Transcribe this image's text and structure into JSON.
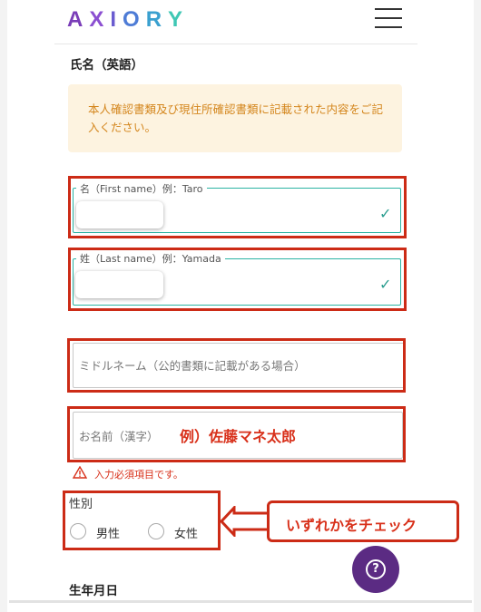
{
  "header": {
    "logo_letters": [
      {
        "ch": "A",
        "color": "#7a3db8"
      },
      {
        "ch": "X",
        "color": "#8b4fd1"
      },
      {
        "ch": "I",
        "color": "#6a5cd0"
      },
      {
        "ch": "O",
        "color": "#4e7cd6"
      },
      {
        "ch": "R",
        "color": "#3aa0cf"
      },
      {
        "ch": "Y",
        "color": "#3fc7b4"
      }
    ]
  },
  "section": {
    "name_english_label": "氏名（英語）"
  },
  "notice": {
    "text": "本人確認書類及び現住所確認書類に記載された内容をご記入ください。"
  },
  "fields": {
    "first_name": {
      "legend": "名（First name）例：Taro",
      "status_icon": "check-icon"
    },
    "last_name": {
      "legend": "姓（Last name）例：Yamada",
      "status_icon": "check-icon"
    },
    "middle_name": {
      "placeholder": "ミドルネーム（公的書類に記載がある場合）"
    },
    "kanji_name": {
      "placeholder": "お名前（漢字）",
      "example": "例）佐藤マネ太郎"
    }
  },
  "error": {
    "icon": "warning-icon",
    "text": "入力必須項目です。"
  },
  "gender": {
    "label": "性別",
    "options": [
      "男性",
      "女性"
    ]
  },
  "callout": {
    "text": "いずれかをチェック"
  },
  "next_section": {
    "label": "生年月日"
  },
  "colors": {
    "accent_teal": "#2bb3a3",
    "annotation_red": "#cc2b16",
    "help_purple": "#5b2b83",
    "notice_bg": "#fdf3e0",
    "notice_text": "#d4861d"
  }
}
